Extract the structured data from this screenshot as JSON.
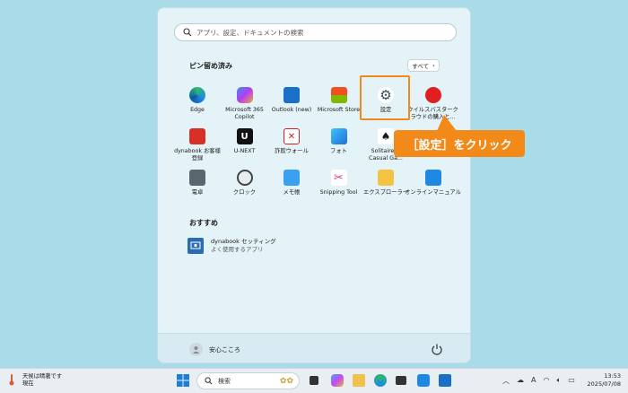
{
  "start_menu": {
    "search_placeholder": "アプリ、設定、ドキュメントの検索",
    "pinned_title": "ピン留め済み",
    "all_button": "すべて",
    "pinned": [
      {
        "label": "Edge",
        "icon": "edge-icon"
      },
      {
        "label": "Microsoft 365\nCopilot",
        "icon": "m365-copilot-icon"
      },
      {
        "label": "Outlook (new)",
        "icon": "outlook-icon"
      },
      {
        "label": "Microsoft Store",
        "icon": "store-icon"
      },
      {
        "label": "設定",
        "icon": "settings-gear-icon"
      },
      {
        "label": "ウイルスバスターク\nラウドの購入と...",
        "icon": "virusbuster-icon"
      },
      {
        "label": "dynabook お客様\n登録",
        "icon": "dynabook-registration-icon"
      },
      {
        "label": "U-NEXT",
        "icon": "unext-icon"
      },
      {
        "label": "詐欺ウォール",
        "icon": "fraud-wall-icon"
      },
      {
        "label": "フォト",
        "icon": "photos-icon"
      },
      {
        "label": "Solitaire &\nCasual Ga...",
        "icon": "solitaire-icon"
      },
      {
        "label": "",
        "icon": "hidden-app-icon"
      },
      {
        "label": "電卓",
        "icon": "calculator-icon"
      },
      {
        "label": "クロック",
        "icon": "clock-icon"
      },
      {
        "label": "メモ帳",
        "icon": "notepad-icon"
      },
      {
        "label": "Snipping Tool",
        "icon": "snipping-tool-icon"
      },
      {
        "label": "エクスプローラー",
        "icon": "explorer-folder-icon"
      },
      {
        "label": "オンラインマニュアル",
        "icon": "online-manual-icon"
      }
    ],
    "recommended_title": "おすすめ",
    "recommended": {
      "title": "dynabook セッティング",
      "subtitle": "よく使用するアプリ"
    },
    "user_name": "安心こころ"
  },
  "callout": {
    "text": "［設定］をクリック",
    "color": "#f28a1a"
  },
  "taskbar": {
    "weather_line1": "天候は晴著です",
    "weather_line2": "現在",
    "search_label": "検索",
    "time": "13:53",
    "date": "2025/07/08",
    "ime": "A"
  }
}
